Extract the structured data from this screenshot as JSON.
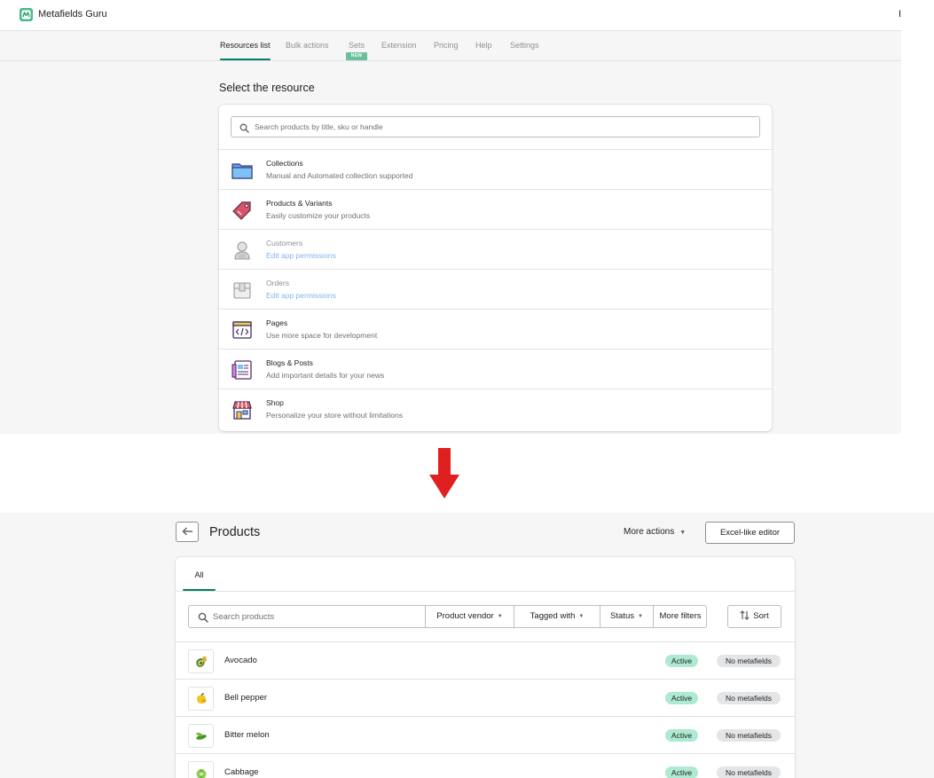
{
  "app": {
    "name": "Metafields Guru",
    "edge_text": "I"
  },
  "nav": {
    "tabs": [
      {
        "label": "Resources list"
      },
      {
        "label": "Bulk actions"
      },
      {
        "label": "Sets"
      },
      {
        "label": "Extension"
      },
      {
        "label": "Pricing"
      },
      {
        "label": "Help"
      },
      {
        "label": "Settings"
      }
    ],
    "active_tab": "Resources list",
    "sets_badge": "NEW"
  },
  "resources": {
    "title": "Select the resource",
    "search_placeholder": "Search products by title, sku or handle",
    "items": [
      {
        "title": "Collections",
        "description": "Manual and Automated collection supported",
        "icon": "folder-icon",
        "enabled": true
      },
      {
        "title": "Products & Variants",
        "description": "Easily customize your products",
        "icon": "price-tag-icon",
        "enabled": true
      },
      {
        "title": "Customers",
        "description": "Edit app permissions",
        "icon": "customer-icon",
        "enabled": false
      },
      {
        "title": "Orders",
        "description": "Edit app permissions",
        "icon": "box-icon",
        "enabled": false
      },
      {
        "title": "Pages",
        "description": "Use more space for development",
        "icon": "code-page-icon",
        "enabled": true
      },
      {
        "title": "Blogs & Posts",
        "description": "Add important details for your news",
        "icon": "blog-icon",
        "enabled": true
      },
      {
        "title": "Shop",
        "description": "Personalize your store without limitations",
        "icon": "storefront-icon",
        "enabled": true
      }
    ]
  },
  "products_page": {
    "title": "Products",
    "more_actions": "More actions",
    "excel_button": "Excel-like editor",
    "tabs": [
      {
        "label": "All"
      }
    ],
    "search_placeholder": "Search products",
    "filters": [
      {
        "label": "Product vendor"
      },
      {
        "label": "Tagged with"
      },
      {
        "label": "Status"
      },
      {
        "label": "More filters"
      }
    ],
    "sort_label": "Sort",
    "rows": [
      {
        "name": "Avocado",
        "status": "Active",
        "metafields": "No metafields",
        "thumb_icon": "avocado-icon"
      },
      {
        "name": "Bell pepper",
        "status": "Active",
        "metafields": "No metafields",
        "thumb_icon": "bell-pepper-icon"
      },
      {
        "name": "Bitter melon",
        "status": "Active",
        "metafields": "No metafields",
        "thumb_icon": "bitter-melon-icon"
      },
      {
        "name": "Cabbage",
        "status": "Active",
        "metafields": "No metafields",
        "thumb_icon": "cabbage-icon"
      }
    ]
  },
  "colors": {
    "accent": "#008060",
    "active_badge": "#aee9d1",
    "neutral_badge": "#e4e5e7",
    "permission_link": "#7fb6e8",
    "arrow": "#e02020"
  }
}
